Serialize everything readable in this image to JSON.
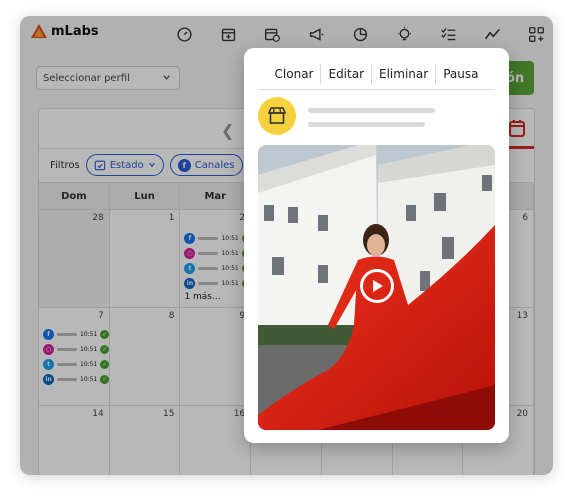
{
  "app": {
    "brand": "mLabs"
  },
  "topbar": {
    "icons": [
      "dashboard-icon",
      "calendar-add-icon",
      "calendar-clock-icon",
      "megaphone-icon",
      "pie-chart-icon",
      "lightbulb-icon",
      "checklist-icon",
      "trend-line-icon",
      "apps-add-icon"
    ]
  },
  "profile_select": {
    "value": "Seleccionar perfil"
  },
  "action_button": {
    "label_visible": "ón"
  },
  "filters": {
    "label": "Filtros",
    "chips": [
      {
        "label": "Estado"
      },
      {
        "label": "Canales"
      }
    ]
  },
  "calendar": {
    "days_of_week": [
      "Dom",
      "Lun",
      "Mar",
      "",
      "",
      "",
      ""
    ],
    "weeks": [
      {
        "days": [
          "28",
          "1",
          "2",
          "",
          "",
          "",
          "6"
        ]
      },
      {
        "days": [
          "7",
          "8",
          "9",
          "",
          "",
          "",
          "13"
        ]
      },
      {
        "days": [
          "14",
          "15",
          "16",
          "",
          "",
          "",
          "20"
        ]
      }
    ],
    "post_time": "10:51",
    "more_label": "1 más..."
  },
  "popup": {
    "actions": [
      "Clonar",
      "Editar",
      "Eliminar",
      "Pausa"
    ]
  },
  "colors": {
    "facebook": "#1877f2",
    "instagram": "#d6249f",
    "twitter": "#1da1f2",
    "linkedin": "#0a66c2",
    "check": "#49a32d",
    "chip": "#2a5bd7",
    "accent_red": "#d62828",
    "green_button": "#5aa83a",
    "store_badge": "#f4d13d"
  }
}
